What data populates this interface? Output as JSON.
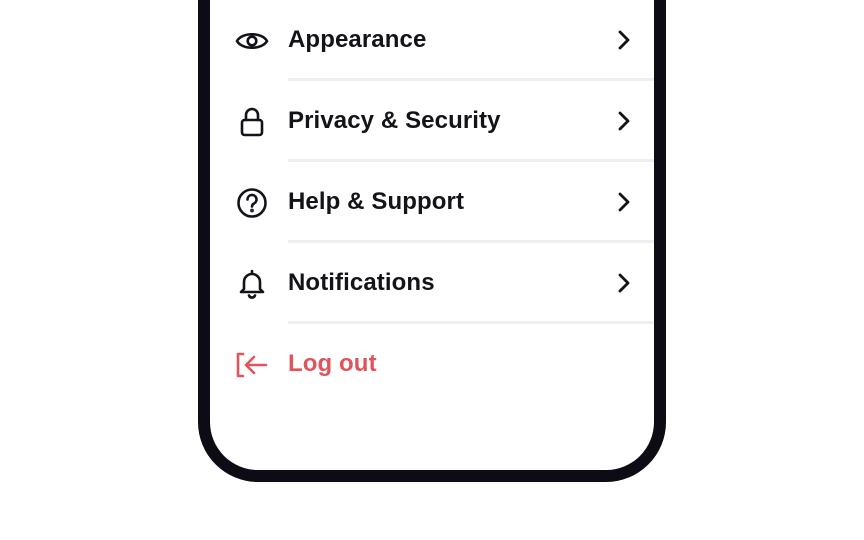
{
  "menu": {
    "items": [
      {
        "label": "Appearance",
        "icon": "eye-icon"
      },
      {
        "label": "Privacy & Security",
        "icon": "lock-icon"
      },
      {
        "label": "Help & Support",
        "icon": "help-circle-icon"
      },
      {
        "label": "Notifications",
        "icon": "bell-icon"
      }
    ],
    "logout": {
      "label": "Log out",
      "icon": "logout-icon"
    }
  },
  "colors": {
    "frame": "#0d0c14",
    "text": "#14131a",
    "danger": "#e0555b",
    "divider": "#eeeeef"
  }
}
